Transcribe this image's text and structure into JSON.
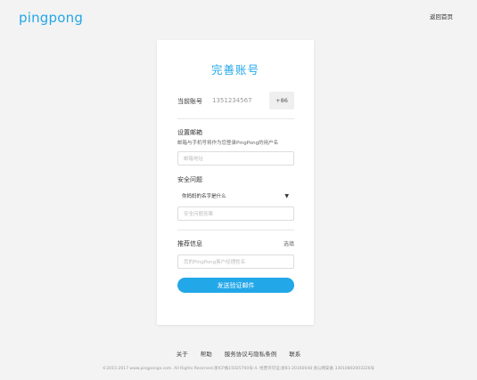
{
  "header": {
    "logo_text": "pingpong",
    "back_home": "返回首页"
  },
  "form": {
    "title": "完善账号",
    "account_label": "当前账号",
    "account_value": "1351234567",
    "country_code": "+86",
    "email_label": "设置邮箱",
    "email_hint": "邮箱与手机号将作为您登录PingPong的用户名",
    "email_placeholder": "邮箱地址",
    "security_label": "安全问题",
    "security_question": "你妈妈的名字是什么",
    "security_answer_placeholder": "安全问题答案",
    "referral_label": "推荐信息",
    "referral_optional": "选填",
    "referral_placeholder": "您的PingPong客户经理姓名",
    "submit_label": "发送验证邮件"
  },
  "footer": {
    "links": [
      "关于",
      "帮助",
      "服务协议与隐私条例",
      "联系"
    ],
    "copyright": "©2015-2017 www.pingpongx.com. All Rights Reserved.浙ICP备15025700号-4. 经营许可证:浙B1-20160048 浙公网安备 33010802003226号"
  },
  "colors": {
    "accent": "#22a7e8",
    "background": "#f3f3f3"
  }
}
